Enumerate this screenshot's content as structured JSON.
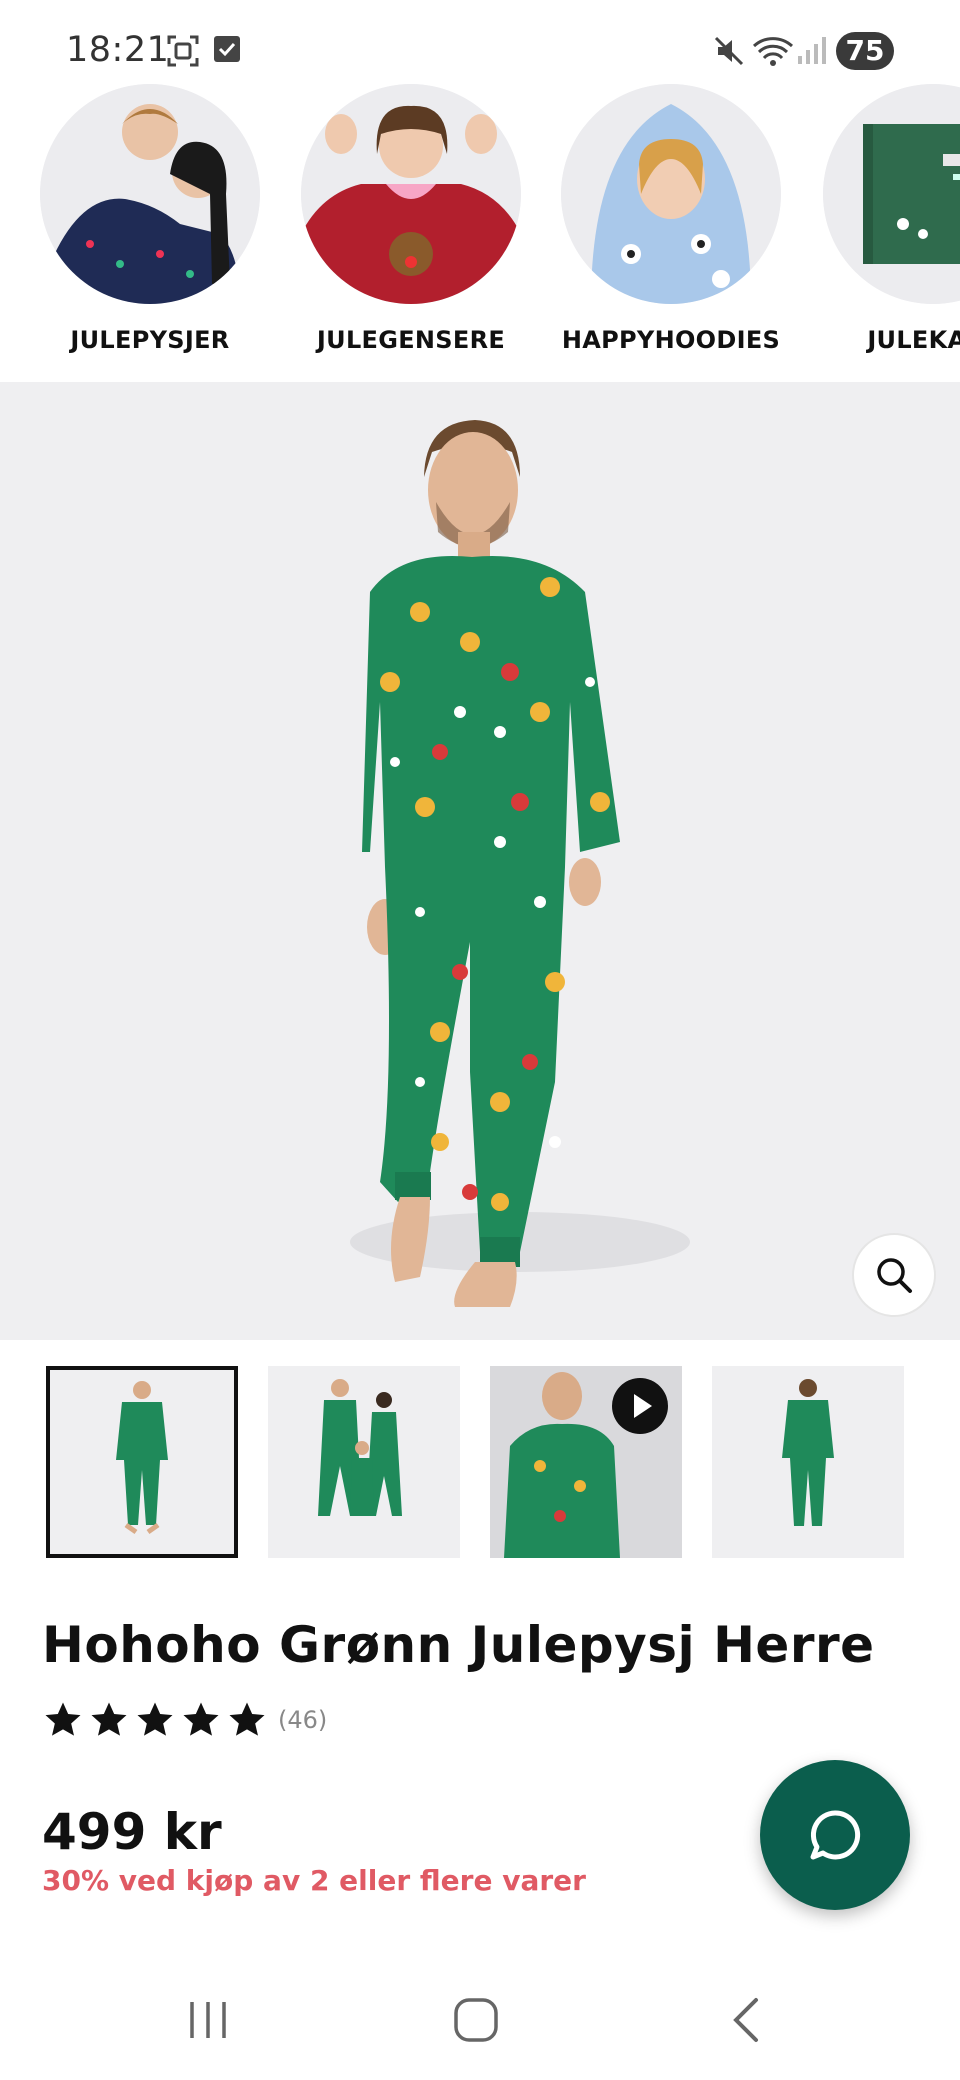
{
  "status": {
    "time": "18:21",
    "battery": "75"
  },
  "categories": [
    {
      "label": "JULEPYSJER"
    },
    {
      "label": "JULEGENSERE"
    },
    {
      "label": "HAPPYHOODIES"
    },
    {
      "label": "JULEKALE"
    }
  ],
  "product": {
    "title": "Hohoho Grønn Julepysj Herre",
    "rating": 5,
    "reviews": "(46)",
    "price": "499 kr",
    "promo": "30% ved kjøp av 2 eller flere varer"
  },
  "colors": {
    "accent": "#0b5e4d",
    "promo": "#e05a64",
    "pajama_green": "#1f8a5a"
  },
  "icons": {
    "zoom": "search-icon",
    "chat": "chat-bubble-icon",
    "play": "play-icon"
  }
}
